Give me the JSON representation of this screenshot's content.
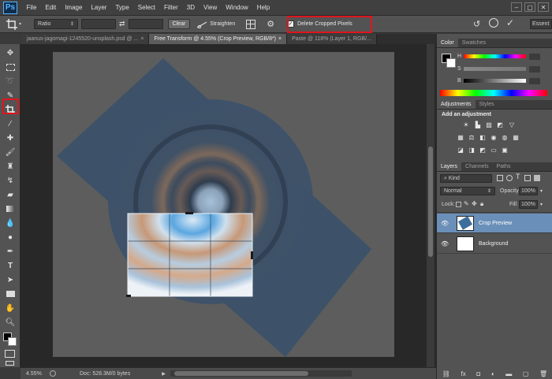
{
  "app": {
    "logo": "Ps",
    "menu": [
      "File",
      "Edit",
      "Image",
      "Layer",
      "Type",
      "Select",
      "Filter",
      "3D",
      "View",
      "Window",
      "Help"
    ]
  },
  "options_bar": {
    "ratio_label": "Ratio",
    "clear_label": "Clear",
    "straighten_label": "Straighten",
    "delete_cropped_label": "Delete Cropped Pixels",
    "delete_cropped_checked": true,
    "workspace_label": "Essent"
  },
  "tabs": [
    {
      "label": "jaanus-jagomagi-1245520-unsplash.psd @ ..."
    },
    {
      "label": "Free Transform @ 4.55% (Crop Preview, RGB/8*)"
    },
    {
      "label": "Paste @ 118% (Layer 1, RGB/..."
    }
  ],
  "status": {
    "zoom": "4.55%",
    "doc": "Doc: 528.3M/0 bytes"
  },
  "color_panel": {
    "tabs": [
      "Color",
      "Swatches"
    ],
    "h_label": "H",
    "s_label": "S",
    "b_label": "B",
    "h_value": "",
    "s_value": "",
    "b_value": "",
    "pct": "%",
    "deg": "°"
  },
  "adjustments_panel": {
    "tabs": [
      "Adjustments",
      "Styles"
    ],
    "heading": "Add an adjustment"
  },
  "layers_panel": {
    "tabs": [
      "Layers",
      "Channels",
      "Paths"
    ],
    "kind_label": "Kind",
    "blend_mode": "Normal",
    "opacity_label": "Opacity:",
    "opacity_value": "100%",
    "lock_label": "Lock:",
    "fill_label": "Fill:",
    "fill_value": "100%",
    "layers": [
      {
        "name": "Crop Preview",
        "selected": true
      },
      {
        "name": "Background",
        "selected": false
      }
    ]
  },
  "colors": {
    "accent_red": "#e0151c",
    "selected_layer": "#6a8fb8"
  }
}
